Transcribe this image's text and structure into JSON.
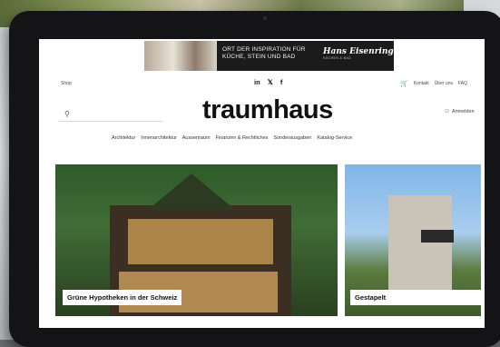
{
  "ad": {
    "headline": "ORT DER INSPIRATION FÜR KÜCHE, STEIN UND BAD",
    "brand": "Hans Eisenring",
    "brand_sub": "KÜCHEN & BAD"
  },
  "topbar": {
    "shop": "Shop",
    "social": [
      "in",
      "𝕏",
      "f"
    ],
    "links": [
      "Kontakt",
      "Über uns",
      "FAQ"
    ]
  },
  "header": {
    "logo": "traumhaus",
    "search_placeholder": "",
    "login": "Anmelden"
  },
  "nav": {
    "items": [
      "Architektur",
      "Innenarchitektur",
      "Aussenraum",
      "Finanzen & Rechtliches",
      "Sonderausgaben",
      "Katalog-Service"
    ]
  },
  "cards": [
    {
      "title": "Grüne Hypotheken in der Schweiz"
    },
    {
      "title": "Gestapelt"
    }
  ],
  "colors": {
    "bezel": "#141416",
    "text": "#111111"
  }
}
